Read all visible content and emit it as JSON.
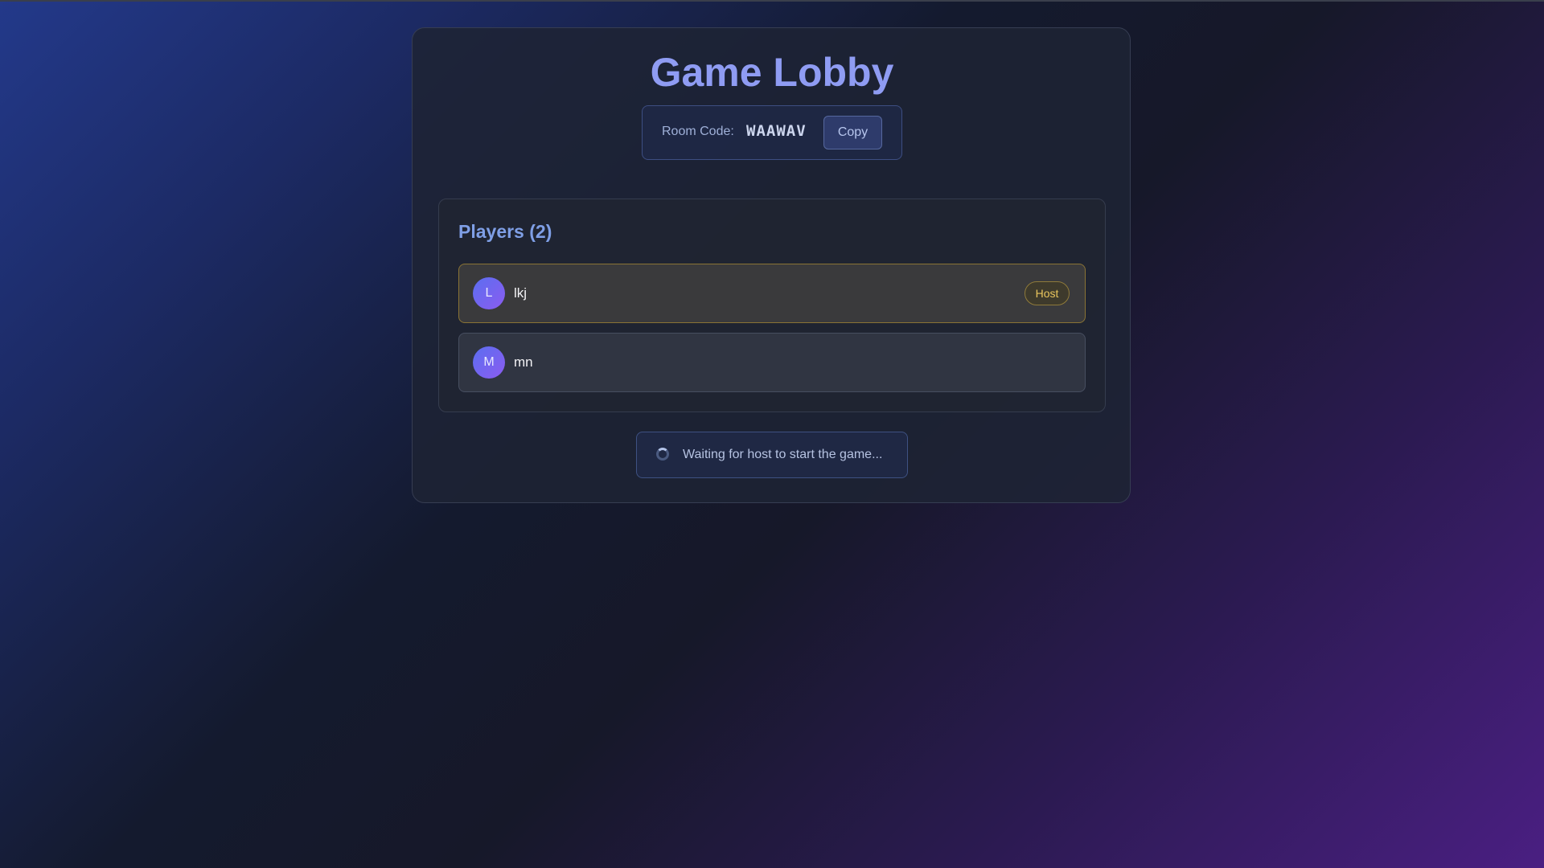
{
  "lobby": {
    "title": "Game Lobby",
    "room_code_label": "Room Code:",
    "room_code": "WAAWAV",
    "copy_label": "Copy"
  },
  "players": {
    "heading": "Players (2)",
    "list": [
      {
        "initial": "L",
        "name": "lkj",
        "badge": "Host"
      },
      {
        "initial": "M",
        "name": "mn"
      }
    ]
  },
  "status": {
    "waiting_text": "Waiting for host to start the game...",
    "icon": "spinner-icon"
  },
  "colors": {
    "title": "#8f9cf3",
    "accent": "#7f9fe6",
    "host_badge": "#e9c55d"
  }
}
